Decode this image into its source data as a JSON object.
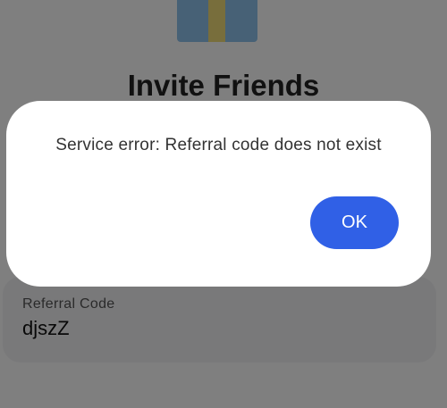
{
  "page": {
    "title": "Invite Friends",
    "referral": {
      "label": "Referral Code",
      "value": "djszZ"
    }
  },
  "dialog": {
    "message": "Service error: Referral code does not exist",
    "ok_label": "OK"
  },
  "colors": {
    "accent": "#3060e6",
    "scrim": "rgba(0,0,0,0.5)",
    "gift_box": "#8fc3ec",
    "gift_ribbon": "#f0dc78"
  },
  "icons": {
    "gift": "gift-icon"
  }
}
